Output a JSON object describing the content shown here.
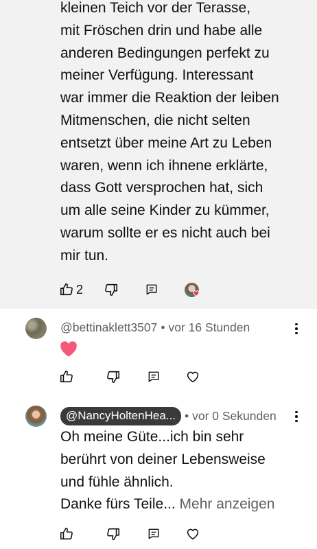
{
  "comment_top": {
    "lines": [
      "kleinen Teich vor der Terasse,",
      "mit Fröschen drin und habe alle",
      "anderen Bedingungen perfekt zu",
      "meiner Verfügung. Interessant",
      "war immer die Reaktion der leiben",
      "Mitmenschen, die nicht selten",
      "entsetzt über meine Art zu Leben",
      "waren, wenn ich ihnene erklärte,",
      "dass Gott versprochen hat, sich",
      "um alle seine Kinder zu kümmer,",
      "warum sollte er es nicht auch bei",
      "mir tun."
    ],
    "like_count": "2",
    "icons": [
      "thumb-up-icon",
      "thumb-down-icon",
      "reply-icon",
      "creator-heart-icon"
    ]
  },
  "comment_bettina": {
    "handle": "@bettinaklett3507",
    "separator": "•",
    "time": "vor 16 Stunden",
    "text": "❤️",
    "icons": [
      "thumb-up-icon",
      "thumb-down-icon",
      "reply-icon",
      "heart-outline-icon"
    ]
  },
  "comment_nancy": {
    "handle": "@NancyHoltenHea...",
    "separator": "•",
    "time": "vor 0 Sekunden",
    "lines": [
      "Oh meine Güte...ich bin sehr",
      "berührt von deiner Lebensweise",
      "und fühle ähnlich."
    ],
    "last_line": "Danke fürs Teile...",
    "show_more": "Mehr anzeigen",
    "icons": [
      "thumb-up-icon",
      "thumb-down-icon",
      "reply-icon",
      "heart-outline-icon"
    ]
  },
  "colors": {
    "top_background": "#f2f2f2",
    "text": "#0f0f0f",
    "meta_text": "#606060",
    "handle_pill": "#3a3a3a",
    "heart": "#e8385a"
  }
}
